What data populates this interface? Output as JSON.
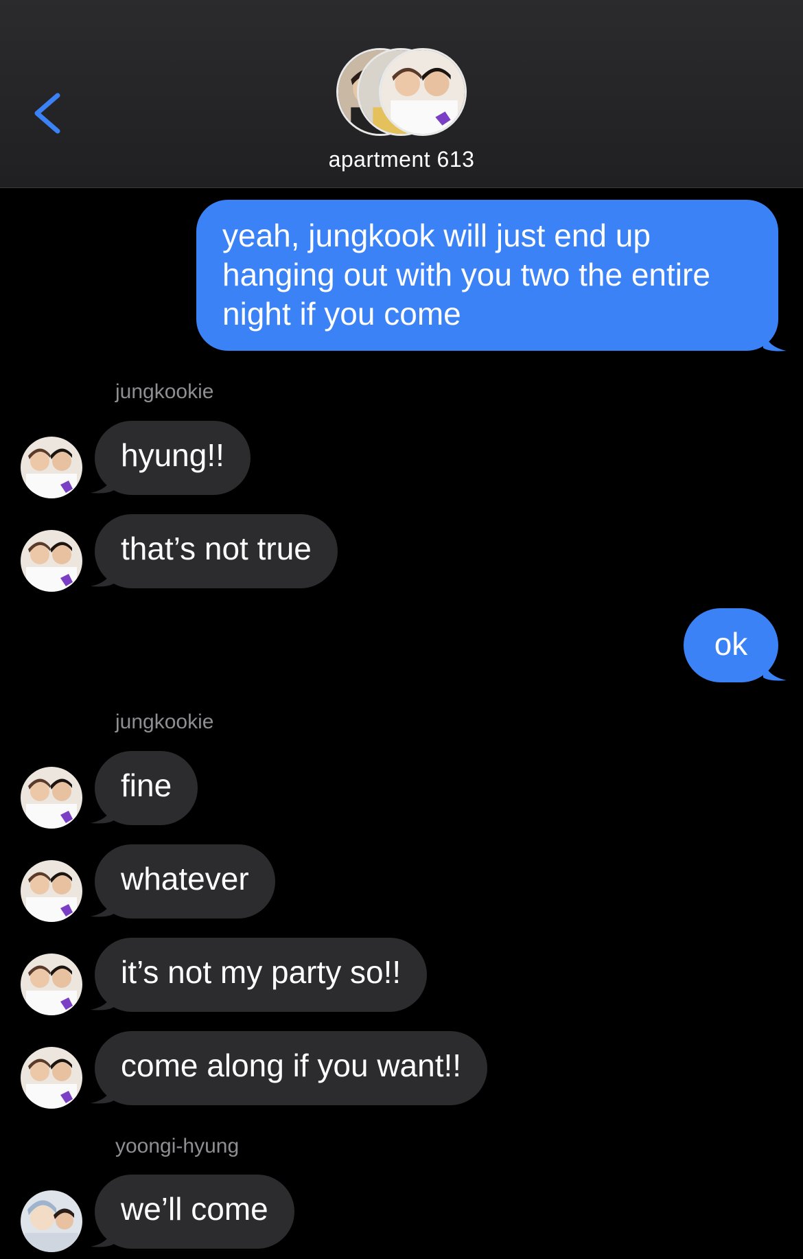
{
  "header": {
    "back_icon": "chevron-left-icon",
    "title": "apartment 613",
    "accent": "#3b82f6"
  },
  "colors": {
    "outgoing_bubble": "#3b82f6",
    "incoming_bubble": "#2c2c2e",
    "sender_label": "#8e8e93",
    "background": "#000000"
  },
  "messages": [
    {
      "direction": "out",
      "text": "yeah, jungkook will just end up hanging out with you two the entire night if you come"
    },
    {
      "direction": "in",
      "sender": "jungkookie",
      "text": "hyung!!"
    },
    {
      "direction": "in",
      "text": "that’s not true"
    },
    {
      "direction": "out",
      "text": "ok"
    },
    {
      "direction": "in",
      "sender": "jungkookie",
      "text": "fine"
    },
    {
      "direction": "in",
      "text": "whatever"
    },
    {
      "direction": "in",
      "text": "it’s not my party so!!"
    },
    {
      "direction": "in",
      "text": "come along if you want!!"
    },
    {
      "direction": "in",
      "sender": "yoongi-hyung",
      "text": "we’ll come"
    }
  ]
}
